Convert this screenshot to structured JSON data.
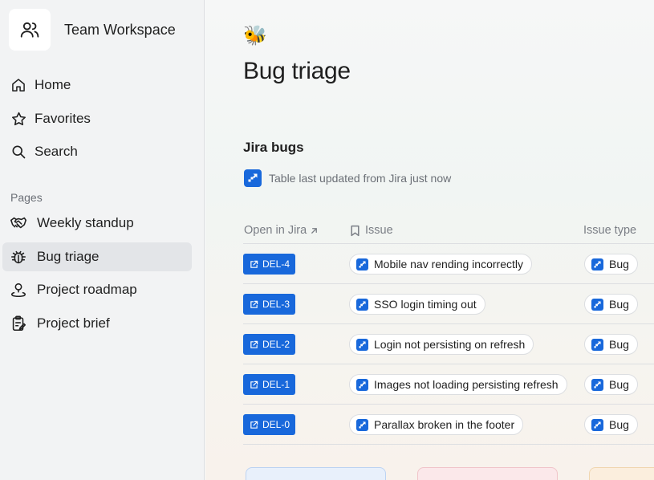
{
  "workspace": {
    "title": "Team Workspace",
    "icon": "team-icon"
  },
  "nav": [
    {
      "label": "Home",
      "icon": "home-icon"
    },
    {
      "label": "Favorites",
      "icon": "star-icon"
    },
    {
      "label": "Search",
      "icon": "search-icon"
    }
  ],
  "pages_section": {
    "label": "Pages"
  },
  "pages": [
    {
      "label": "Weekly standup",
      "icon": "handshake-icon",
      "active": false
    },
    {
      "label": "Bug triage",
      "icon": "bug-icon",
      "active": true
    },
    {
      "label": "Project roadmap",
      "icon": "map-pin-person-icon",
      "active": false
    },
    {
      "label": "Project brief",
      "icon": "clipboard-icon",
      "active": false
    }
  ],
  "page": {
    "emoji": "🐝",
    "title": "Bug triage"
  },
  "jira_block": {
    "title": "Jira bugs",
    "sync_status": "Table last updated from Jira just now",
    "columns": {
      "open_in_jira": "Open in Jira",
      "issue": "Issue",
      "issue_type": "Issue type"
    },
    "rows": [
      {
        "key": "DEL-4",
        "summary": "Mobile nav rending incorrectly",
        "type": "Bug"
      },
      {
        "key": "DEL-3",
        "summary": "SSO login timing out",
        "type": "Bug"
      },
      {
        "key": "DEL-2",
        "summary": "Login not persisting on refresh",
        "type": "Bug"
      },
      {
        "key": "DEL-1",
        "summary": "Images not loading persisting refresh",
        "type": "Bug"
      },
      {
        "key": "DEL-0",
        "summary": "Parallax broken in the footer",
        "type": "Bug"
      }
    ]
  },
  "colors": {
    "jira_blue": "#1868db",
    "sidebar_bg": "#f2f3f4",
    "active_item_bg": "#e3e5e8"
  }
}
